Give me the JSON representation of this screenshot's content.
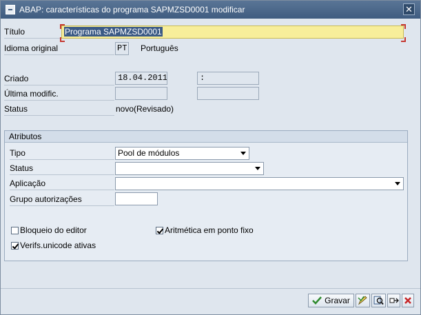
{
  "window": {
    "title": "ABAP: características do programa SAPMZSD0001 modificar",
    "close_symbol": "✕"
  },
  "header_fields": {
    "titulo_label": "Título",
    "titulo_value": "Programa SAPMZSD0001",
    "idioma_label": "Idioma original",
    "idioma_code": "PT",
    "idioma_name": "Português",
    "criado_label": "Criado",
    "criado_date": "18.04.2011",
    "criado_user": ":",
    "ultima_label": "Última modific.",
    "ultima_date": "",
    "ultima_user": "",
    "status_label": "Status",
    "status_value": "novo(Revisado)"
  },
  "atributos": {
    "title": "Atributos",
    "tipo_label": "Tipo",
    "tipo_value": "Pool de módulos",
    "status_label": "Status",
    "status_value": "",
    "aplicacao_label": "Aplicação",
    "aplicacao_value": "",
    "grupo_label": "Grupo autorizações",
    "grupo_value": "",
    "bloqueio_label": "Bloqueio do editor",
    "bloqueio_checked": false,
    "aritmetica_label": "Aritmética em ponto fixo",
    "aritmetica_checked": true,
    "unicode_label": "Verifs.unicode ativas",
    "unicode_checked": true
  },
  "footer": {
    "gravar_label": "Gravar",
    "icons": [
      "check-icon",
      "edit-icon",
      "search-icon",
      "layout-icon",
      "cancel-icon"
    ],
    "colors": {
      "check": "#2e8a2e",
      "cancel": "#c8282a"
    }
  }
}
